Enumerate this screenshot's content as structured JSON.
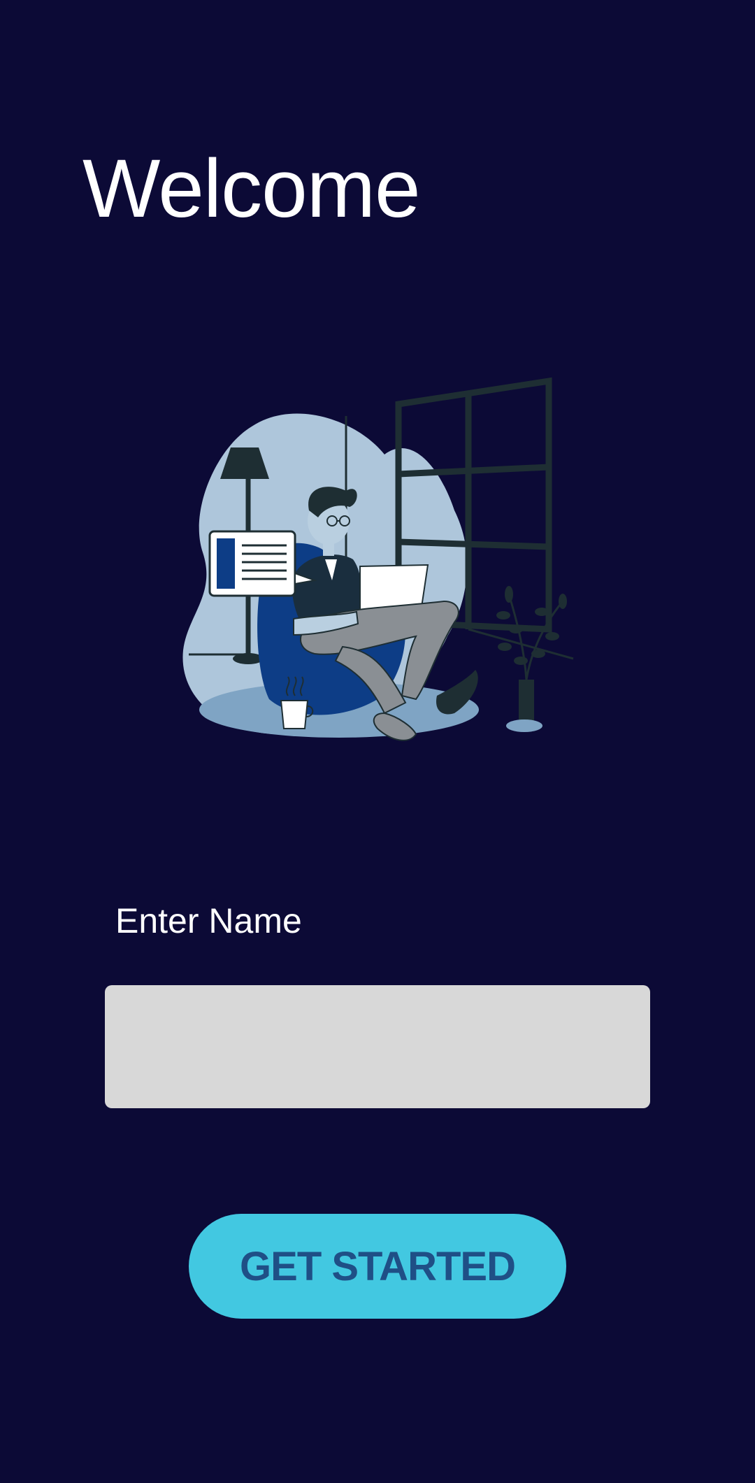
{
  "header": {
    "title": "Welcome"
  },
  "illustration": {
    "icon": "person-with-laptop-illustration"
  },
  "form": {
    "name_label": "Enter Name",
    "name_value": "",
    "name_placeholder": ""
  },
  "actions": {
    "get_started_label": "GET STARTED"
  },
  "colors": {
    "background": "#0c0a36",
    "accent": "#42c8e1",
    "button_text": "#1f4f86",
    "input_background": "#d8d8d8"
  }
}
